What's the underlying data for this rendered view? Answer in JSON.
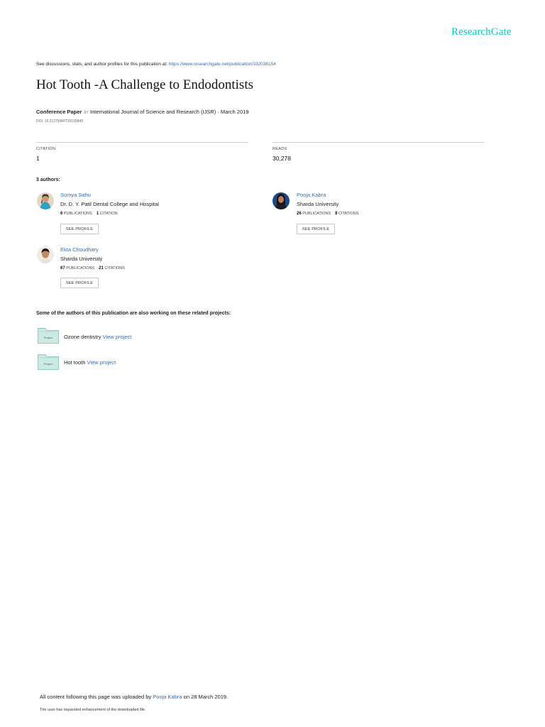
{
  "brand": "ResearchGate",
  "discussions": {
    "prefix": "See discussions, stats, and author profiles for this publication at: ",
    "url": "https://www.researchgate.net/publication/332036154"
  },
  "title": "Hot Tooth -A Challenge to Endodontists",
  "meta": {
    "type": "Conference Paper",
    "in": "in",
    "venue": "International Journal of Science and Research (IJSR) · March 2019",
    "doi": "DOI: 10.21275/ART20195849"
  },
  "stats": {
    "citation_label": "CITATION",
    "citation_value": "1",
    "reads_label": "READS",
    "reads_value": "30,278"
  },
  "authors_heading": "3 authors:",
  "authors": [
    {
      "name": "Somya Sahu",
      "institution": "Dr. D. Y. Patil Dental College and Hospital",
      "publications_count": "6",
      "publications_label": "PUBLICATIONS",
      "citations_count": "1",
      "citations_label": "CITATION",
      "button": "SEE PROFILE"
    },
    {
      "name": "Pooja Kabra",
      "institution": "Sharda University",
      "publications_count": "26",
      "publications_label": "PUBLICATIONS",
      "citations_count": "8",
      "citations_label": "CITATIONS",
      "button": "SEE PROFILE"
    },
    {
      "name": "Ekta Choudhary",
      "institution": "Sharda University",
      "publications_count": "67",
      "publications_label": "PUBLICATIONS",
      "citations_count": "21",
      "citations_label": "CITATIONS",
      "button": "SEE PROFILE"
    }
  ],
  "related_heading": "Some of the authors of this publication are also working on these related projects:",
  "projects": [
    {
      "folder_label": "Project",
      "name": "Ozone dentistry",
      "link": "View project"
    },
    {
      "folder_label": "Project",
      "name": "Hot tooth",
      "link": "View project"
    }
  ],
  "footer": {
    "uploaded_prefix": "All content following this page was uploaded by ",
    "uploader": "Pooja Kabra",
    "uploaded_suffix": " on 28 March 2019.",
    "note": "The user has requested enhancement of the downloaded file."
  },
  "colors": {
    "brand": "#00ccbb",
    "link": "#3a6bb0",
    "folder": "#cde9e4"
  }
}
